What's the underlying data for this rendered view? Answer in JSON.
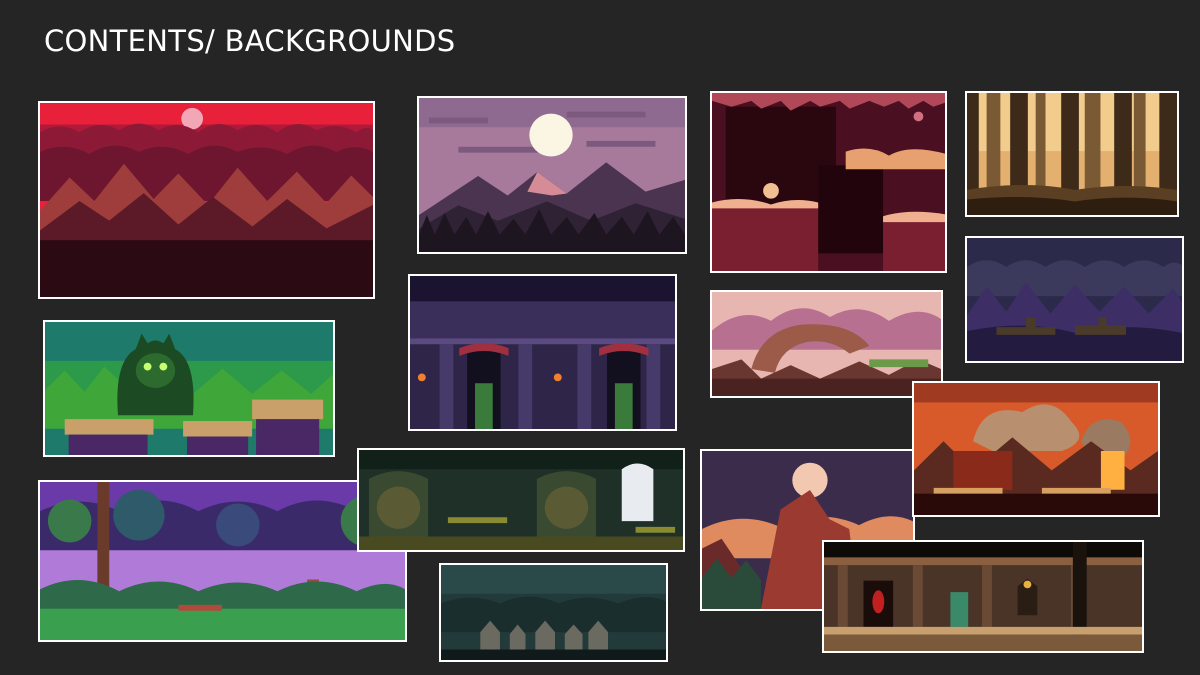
{
  "slide": {
    "title": "CONTENTS/ BACKGROUNDS"
  },
  "thumbnails": [
    {
      "id": "crimson-mountains",
      "scene": "red-sky-mountains"
    },
    {
      "id": "purple-dusk-mountains",
      "scene": "moon-over-mountains"
    },
    {
      "id": "flesh-cave",
      "scene": "organic-cave-platforms"
    },
    {
      "id": "golden-forest",
      "scene": "sepia-forest"
    },
    {
      "id": "green-demon-swamp",
      "scene": "demon-tree-platforms"
    },
    {
      "id": "gothic-castle-hall",
      "scene": "castle-windows-torches"
    },
    {
      "id": "pink-rock-arch",
      "scene": "rock-arch-clouds"
    },
    {
      "id": "night-purple-hills",
      "scene": "dark-village-hills"
    },
    {
      "id": "violet-jungle",
      "scene": "purple-jungle-trees"
    },
    {
      "id": "green-dungeon",
      "scene": "dungeon-arches"
    },
    {
      "id": "moonlit-cliffs",
      "scene": "orange-cliffs-moon"
    },
    {
      "id": "lava-ruins",
      "scene": "volcanic-smoke"
    },
    {
      "id": "foggy-village",
      "scene": "graveyard-houses"
    },
    {
      "id": "temple-corridor",
      "scene": "stone-temple-interior"
    }
  ]
}
